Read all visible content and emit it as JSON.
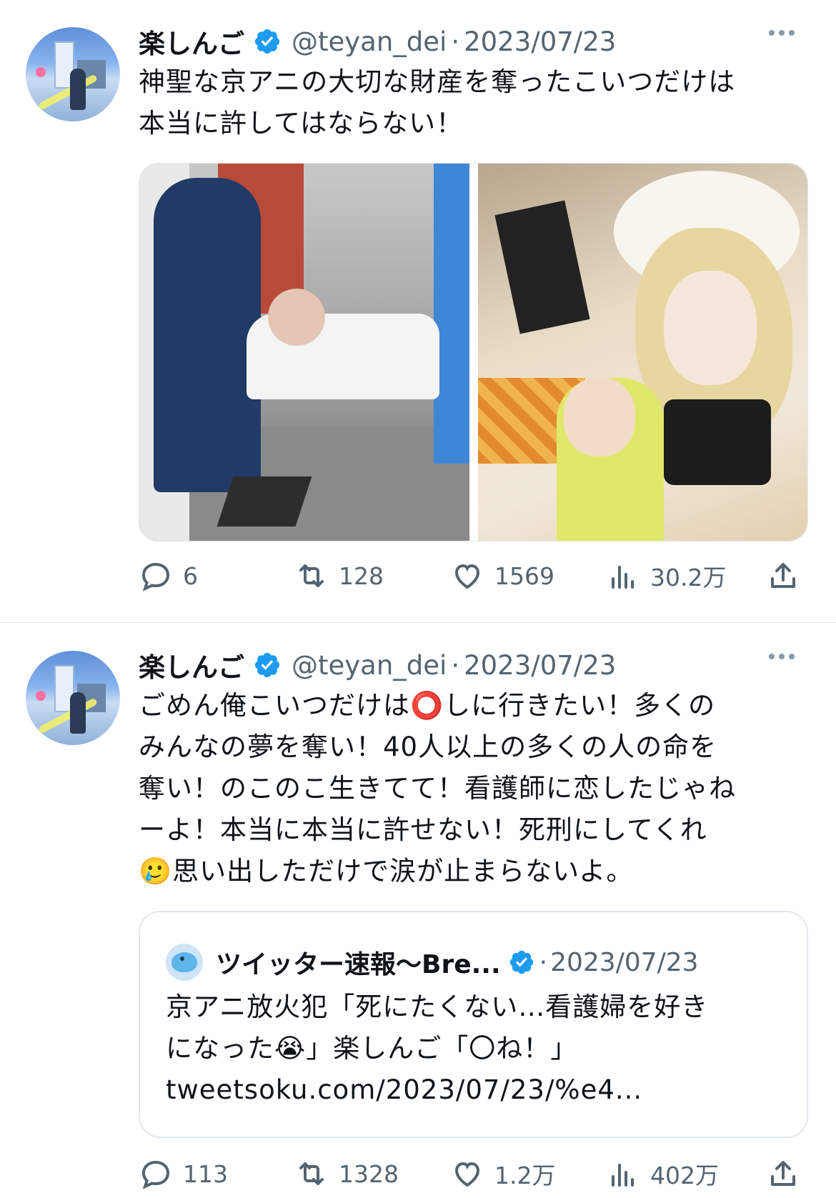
{
  "tweets": [
    {
      "display_name": "楽しんご",
      "handle": "@teyan_dei",
      "separator": "·",
      "date": "2023/07/23",
      "text": "神聖な京アニの大切な財産を奪ったこいつだけは\n本当に許してはならない！",
      "stats": {
        "replies": "6",
        "retweets": "128",
        "likes": "1569",
        "views": "30.2万"
      }
    },
    {
      "display_name": "楽しんご",
      "handle": "@teyan_dei",
      "separator": "·",
      "date": "2023/07/23",
      "text": "ごめん俺こいつだけは⭕しに行きたい！多くの\nみんなの夢を奪い！40人以上の多くの人の命を\n奪い！のこのこ生きてて！看護師に恋したじゃね\nーよ！本当に本当に許せない！死刑にしてくれ\n🥲思い出しただけで涙が止まらないよ。",
      "quote": {
        "name": "ツイッター速報〜Bre...",
        "separator": "·",
        "date": "2023/07/23",
        "text": "京アニ放火犯「死にたくない…看護婦を好き\nになった😭」楽しんご「〇ね！」\ntweetsoku.com/2023/07/23/%e4..."
      },
      "stats": {
        "replies": "113",
        "retweets": "1328",
        "likes": "1.2万",
        "views": "402万"
      }
    }
  ],
  "icons": {
    "reply": "reply-icon",
    "retweet": "retweet-icon",
    "like": "heart-icon",
    "views": "views-icon",
    "share": "share-icon",
    "verified": "verified-badge-icon",
    "more": "more-options-icon"
  },
  "colors": {
    "verified": "#1d9bf0",
    "secondary_text": "#536471",
    "text": "#0f1419",
    "divider": "#e1e8ed"
  }
}
